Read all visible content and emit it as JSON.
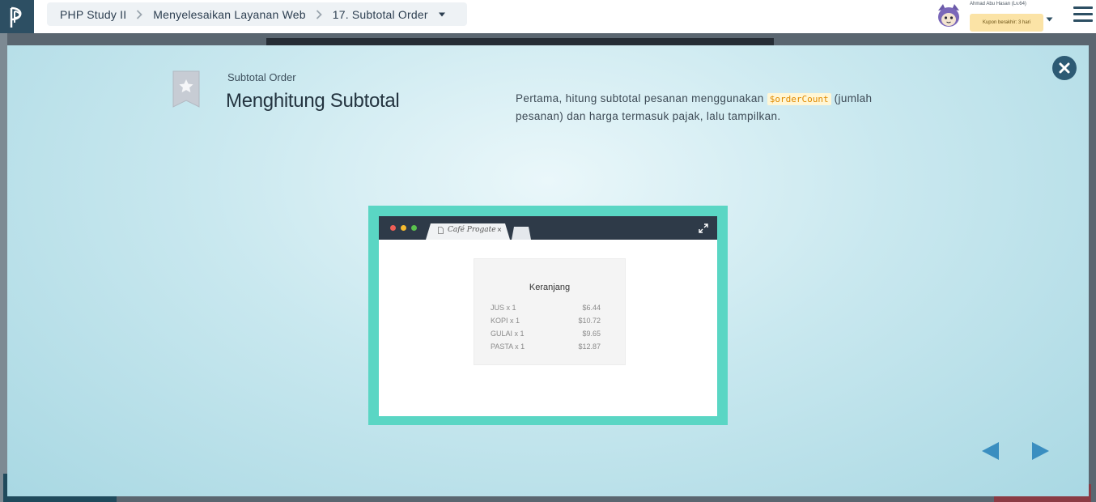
{
  "header": {
    "breadcrumbs": [
      "PHP Study II",
      "Menyelesaikan Layanan Web",
      "17. Subtotal Order"
    ],
    "user": {
      "name": "Ahmad Abu Hasan (Lv.64)",
      "coupon": "Kupon berakhir: 3 hari"
    }
  },
  "slide": {
    "subtitle": "Subtotal Order",
    "title": "Menghitung Subtotal",
    "desc_before": "Pertama, hitung subtotal pesanan menggunakan ",
    "desc_code": "$orderCount",
    "desc_after": " (jumlah pesanan) dan harga termasuk pajak, lalu tampilkan."
  },
  "illustration": {
    "tab_label": "Café Progate",
    "tab_close": "×",
    "cart_title": "Keranjang",
    "items": [
      {
        "name": "JUS  x  1",
        "price": "$6.44"
      },
      {
        "name": "KOPI  x  1",
        "price": "$10.72"
      },
      {
        "name": "GULAI  x  1",
        "price": "$9.65"
      },
      {
        "name": "PASTA  x  1",
        "price": "$12.87"
      }
    ]
  },
  "colors": {
    "brand": "#2d4f63",
    "frame": "#5ad6c4",
    "arrow": "#3a8ec0"
  },
  "icons": [
    "progate-logo-icon",
    "chevron-right-icon",
    "caret-down-icon",
    "hamburger-menu-icon",
    "close-icon",
    "bookmark-star-icon",
    "expand-icon",
    "arrow-left-icon",
    "arrow-right-icon"
  ]
}
